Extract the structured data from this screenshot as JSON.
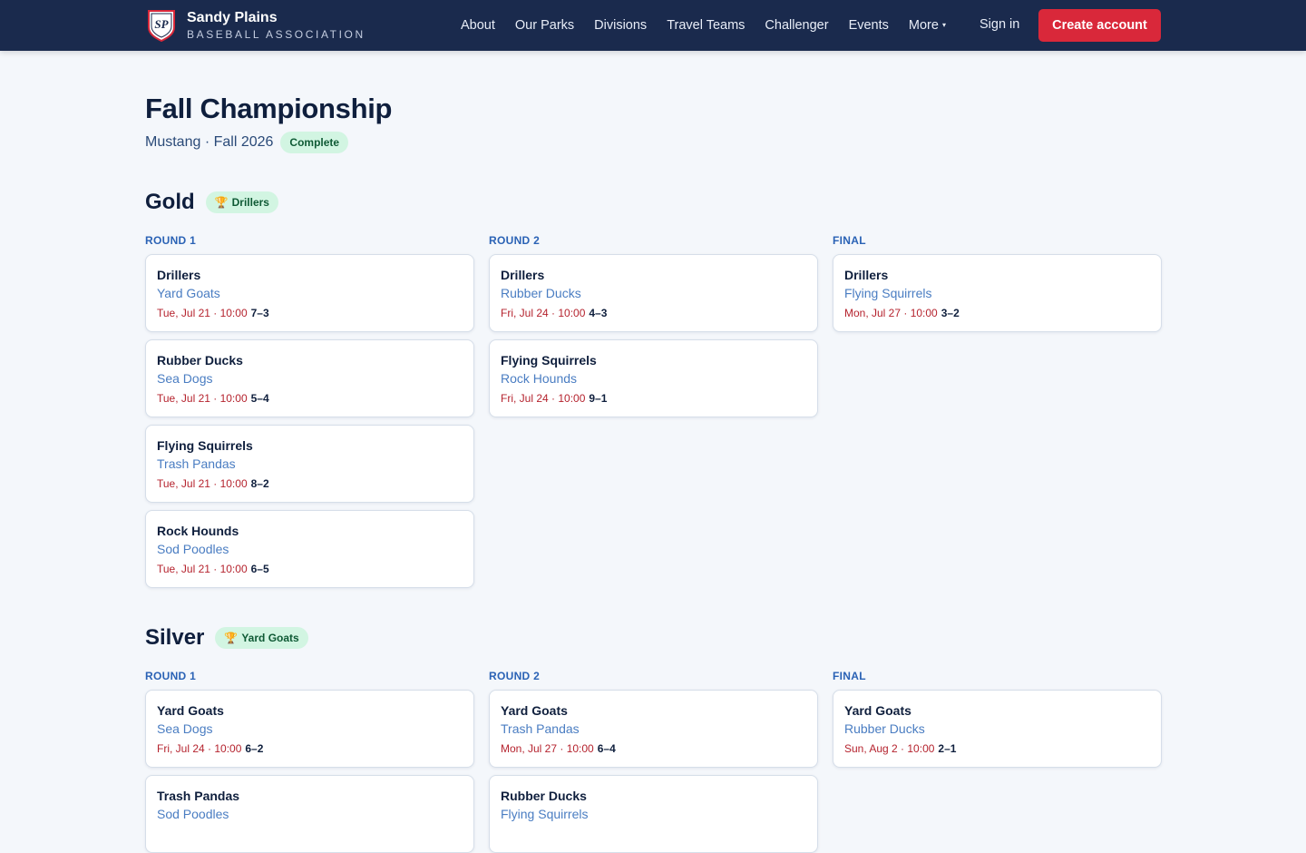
{
  "header": {
    "brand_name": "Sandy Plains",
    "brand_sub": "BASEBALL ASSOCIATION",
    "logo_text": "SP",
    "nav": [
      "About",
      "Our Parks",
      "Divisions",
      "Travel Teams",
      "Challenger",
      "Events",
      "More"
    ],
    "more_caret": "▾",
    "signin": "Sign in",
    "create": "Create account",
    "colors": {
      "bar": "#1a2a4d",
      "accent": "#d9283a"
    }
  },
  "page": {
    "title": "Fall Championship",
    "subtitle": "Mustang · Fall 2026",
    "status": "Complete"
  },
  "brackets": [
    {
      "name": "Gold",
      "trophy_icon": "🏆",
      "champion": "Drillers",
      "rounds": [
        {
          "label": "ROUND 1",
          "matches": [
            {
              "winner": "Drillers",
              "loser": "Yard Goats",
              "when": "Tue, Jul 21 · 10:00",
              "score": "7–3"
            },
            {
              "winner": "Rubber Ducks",
              "loser": "Sea Dogs",
              "when": "Tue, Jul 21 · 10:00",
              "score": "5–4"
            },
            {
              "winner": "Flying Squirrels",
              "loser": "Trash Pandas",
              "when": "Tue, Jul 21 · 10:00",
              "score": "8–2"
            },
            {
              "winner": "Rock Hounds",
              "loser": "Sod Poodles",
              "when": "Tue, Jul 21 · 10:00",
              "score": "6–5"
            }
          ]
        },
        {
          "label": "ROUND 2",
          "matches": [
            {
              "winner": "Drillers",
              "loser": "Rubber Ducks",
              "when": "Fri, Jul 24 · 10:00",
              "score": "4–3"
            },
            {
              "winner": "Flying Squirrels",
              "loser": "Rock Hounds",
              "when": "Fri, Jul 24 · 10:00",
              "score": "9–1"
            }
          ]
        },
        {
          "label": "FINAL",
          "matches": [
            {
              "winner": "Drillers",
              "loser": "Flying Squirrels",
              "when": "Mon, Jul 27 · 10:00",
              "score": "3–2"
            }
          ]
        }
      ]
    },
    {
      "name": "Silver",
      "trophy_icon": "🏆",
      "champion": "Yard Goats",
      "rounds": [
        {
          "label": "ROUND 1",
          "matches": [
            {
              "winner": "Yard Goats",
              "loser": "Sea Dogs",
              "when": "Fri, Jul 24 · 10:00",
              "score": "6–2"
            },
            {
              "winner": "Trash Pandas",
              "loser": "Sod Poodles",
              "when": "",
              "score": ""
            }
          ]
        },
        {
          "label": "ROUND 2",
          "matches": [
            {
              "winner": "Yard Goats",
              "loser": "Trash Pandas",
              "when": "Mon, Jul 27 · 10:00",
              "score": "6–4"
            },
            {
              "winner": "Rubber Ducks",
              "loser": "Flying Squirrels",
              "when": "",
              "score": ""
            }
          ]
        },
        {
          "label": "FINAL",
          "matches": [
            {
              "winner": "Yard Goats",
              "loser": "Rubber Ducks",
              "when": "Sun, Aug 2 · 10:00",
              "score": "2–1"
            }
          ]
        }
      ]
    }
  ]
}
